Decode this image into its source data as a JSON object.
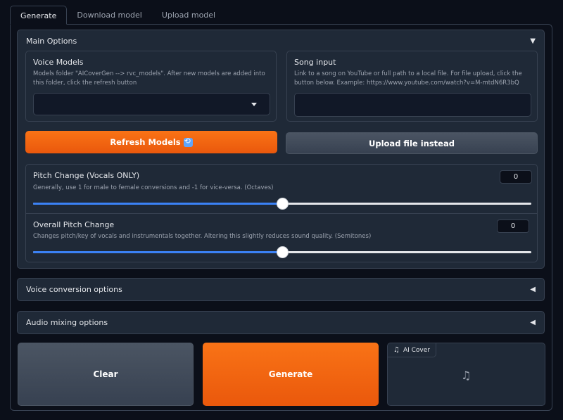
{
  "tabs": [
    {
      "label": "Generate",
      "active": true
    },
    {
      "label": "Download model"
    },
    {
      "label": "Upload model"
    }
  ],
  "main_options": {
    "title": "Main Options",
    "arrow": "▼",
    "voice_models": {
      "title": "Voice Models",
      "info": "Models folder \"AICoverGen --> rvc_models\". After new models are added into this folder, click the refresh button",
      "selected": ""
    },
    "song_input": {
      "title": "Song input",
      "info": "Link to a song on YouTube or full path to a local file. For file upload, click the button below. Example: https://www.youtube.com/watch?v=M-mtdN6R3bQ",
      "value": ""
    },
    "refresh_label": "Refresh Models",
    "refresh_icon": "sync-icon",
    "upload_label": "Upload file instead",
    "pitch_change": {
      "title": "Pitch Change (Vocals ONLY)",
      "info": "Generally, use 1 for male to female conversions and -1 for vice-versa. (Octaves)",
      "value": "0",
      "level": 0.5
    },
    "overall_pitch": {
      "title": "Overall Pitch Change",
      "info": "Changes pitch/key of vocals and instrumentals together. Altering this slightly reduces sound quality. (Semitones)",
      "value": "0",
      "level": 0.5
    }
  },
  "voice_conversion": {
    "title": "Voice conversion options",
    "arrow": "◀"
  },
  "audio_mixing": {
    "title": "Audio mixing options",
    "arrow": "◀"
  },
  "actions": {
    "clear_label": "Clear",
    "generate_label": "Generate"
  },
  "output": {
    "label": "AI Cover",
    "icon": "music-note-icon"
  },
  "colors": {
    "accent": "#f97316",
    "slider": "#3b82f6",
    "panel": "#1f2937",
    "background": "#0b0f19"
  }
}
